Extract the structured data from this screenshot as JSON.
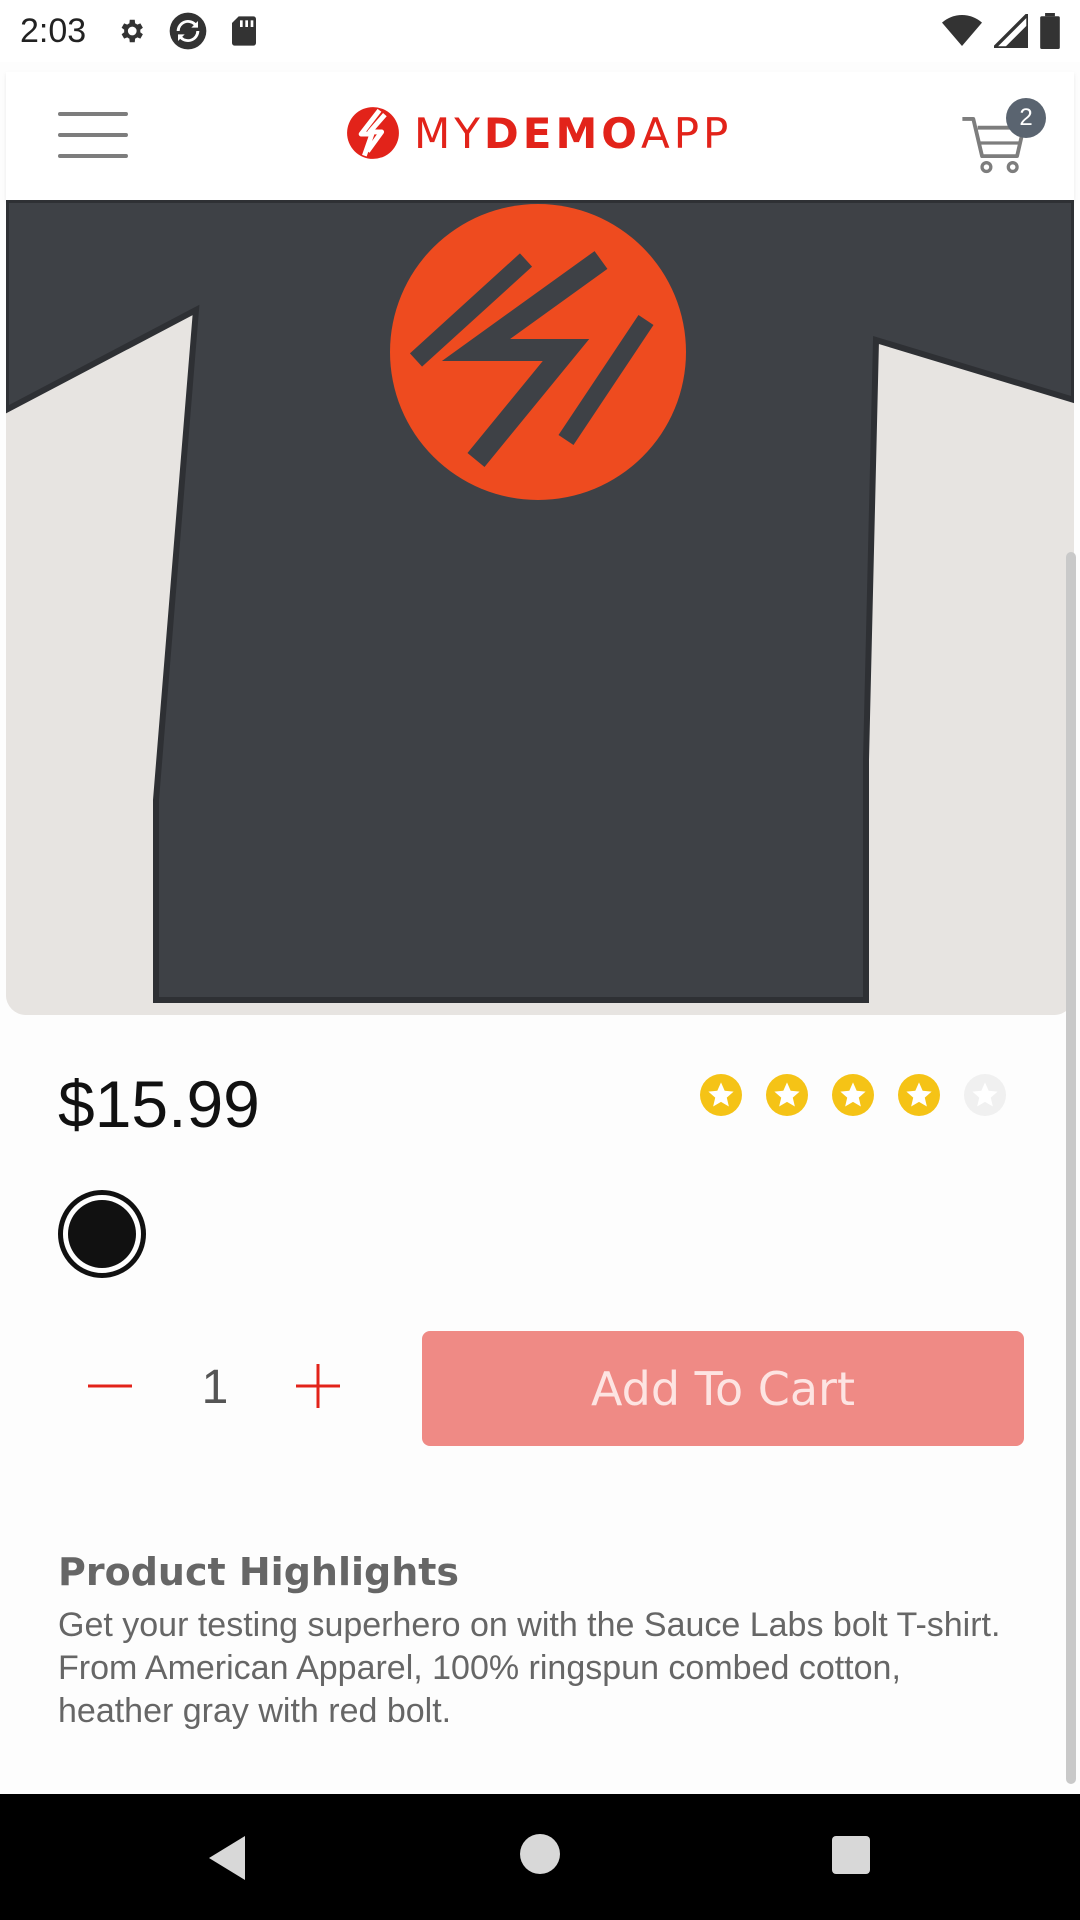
{
  "status_bar": {
    "time": "2:03",
    "icons": [
      "settings-icon",
      "sync-icon",
      "sd-card-icon",
      "wifi-icon",
      "signal-icon",
      "battery-icon"
    ]
  },
  "header": {
    "logo_prefix": "MY",
    "logo_bold": "DEMO",
    "logo_suffix": "APP",
    "cart_count": "2",
    "brand_color": "#e2231a"
  },
  "product": {
    "price": "$15.99",
    "rating": 4,
    "rating_max": 5,
    "selected_color": "#111111",
    "quantity": "1",
    "add_to_cart_label": "Add To Cart",
    "add_to_cart_color": "#ef8a85",
    "highlights_title": "Product Highlights",
    "highlights_text": "Get your testing superhero on with the Sauce Labs bolt T-shirt. From American Apparel, 100% ringspun combed cotton, heather gray with red bolt."
  }
}
